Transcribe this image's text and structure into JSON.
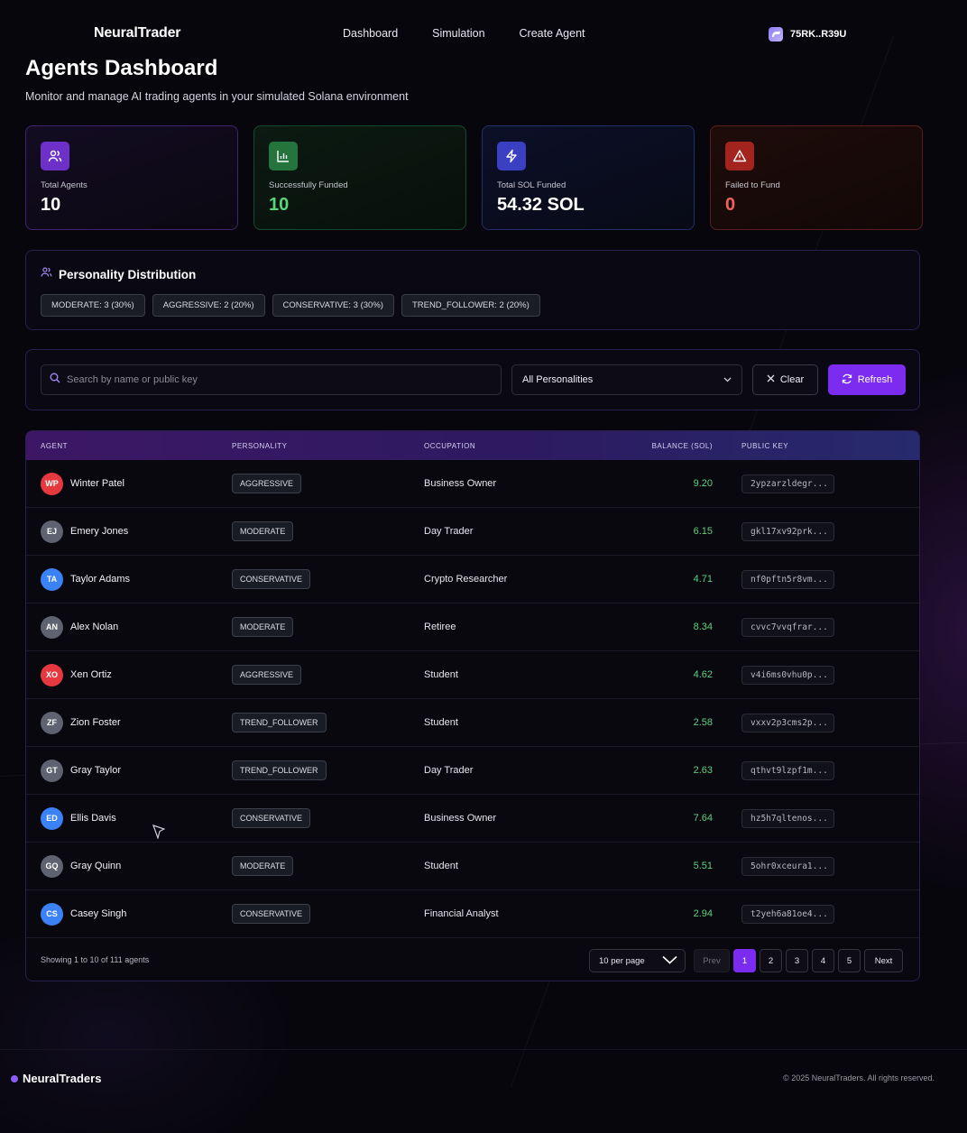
{
  "nav": {
    "brand": "NeuralTrader",
    "links": [
      "Dashboard",
      "Simulation",
      "Create Agent"
    ],
    "wallet": "75RK..R39U"
  },
  "header": {
    "title": "Agents Dashboard",
    "subtitle": "Monitor and manage AI trading agents in your simulated Solana environment"
  },
  "stats": [
    {
      "label": "Total Agents",
      "value": "10",
      "icon": "users-icon",
      "color": "#6d31c9"
    },
    {
      "label": "Successfully Funded",
      "value": "10",
      "icon": "bar-chart-icon",
      "color": "#25733d"
    },
    {
      "label": "Total SOL Funded",
      "value": "54.32 SOL",
      "icon": "lightning-icon",
      "color": "#3b3fc2"
    },
    {
      "label": "Failed to Fund",
      "value": "0",
      "icon": "warning-icon",
      "color": "#a3231e"
    }
  ],
  "distribution": {
    "title": "Personality Distribution",
    "tags": [
      "MODERATE: 3 (30%)",
      "AGGRESSIVE: 2 (20%)",
      "CONSERVATIVE: 3 (30%)",
      "TREND_FOLLOWER: 2 (20%)"
    ]
  },
  "filter": {
    "search_placeholder": "Search by name or public key",
    "personality_selected": "All Personalities",
    "clear_label": "Clear",
    "refresh_label": "Refresh"
  },
  "table": {
    "columns": [
      "AGENT",
      "PERSONALITY",
      "OCCUPATION",
      "BALANCE (SOL)",
      "PUBLIC KEY"
    ],
    "rows": [
      {
        "initials": "WP",
        "avatar_color": "#e5393f",
        "name": "Winter Patel",
        "personality": "AGGRESSIVE",
        "occupation": "Business Owner",
        "balance": "9.20",
        "key": "2ypzarzldegr..."
      },
      {
        "initials": "EJ",
        "avatar_color": "#5f6371",
        "name": "Emery Jones",
        "personality": "MODERATE",
        "occupation": "Day Trader",
        "balance": "6.15",
        "key": "gkl17xv92prk..."
      },
      {
        "initials": "TA",
        "avatar_color": "#3b82f6",
        "name": "Taylor Adams",
        "personality": "CONSERVATIVE",
        "occupation": "Crypto Researcher",
        "balance": "4.71",
        "key": "nf0pftn5r8vm..."
      },
      {
        "initials": "AN",
        "avatar_color": "#5f6371",
        "name": "Alex Nolan",
        "personality": "MODERATE",
        "occupation": "Retiree",
        "balance": "8.34",
        "key": "cvvc7vvqfrar..."
      },
      {
        "initials": "XO",
        "avatar_color": "#e5393f",
        "name": "Xen Ortiz",
        "personality": "AGGRESSIVE",
        "occupation": "Student",
        "balance": "4.62",
        "key": "v4i6ms0vhu0p..."
      },
      {
        "initials": "ZF",
        "avatar_color": "#5f6371",
        "name": "Zion Foster",
        "personality": "TREND_FOLLOWER",
        "occupation": "Student",
        "balance": "2.58",
        "key": "vxxv2p3cms2p..."
      },
      {
        "initials": "GT",
        "avatar_color": "#5f6371",
        "name": "Gray Taylor",
        "personality": "TREND_FOLLOWER",
        "occupation": "Day Trader",
        "balance": "2.63",
        "key": "qthvt9lzpf1m..."
      },
      {
        "initials": "ED",
        "avatar_color": "#3b82f6",
        "name": "Ellis Davis",
        "personality": "CONSERVATIVE",
        "occupation": "Business Owner",
        "balance": "7.64",
        "key": "hz5h7qltenos..."
      },
      {
        "initials": "GQ",
        "avatar_color": "#5f6371",
        "name": "Gray Quinn",
        "personality": "MODERATE",
        "occupation": "Student",
        "balance": "5.51",
        "key": "5ohr0xceura1..."
      },
      {
        "initials": "CS",
        "avatar_color": "#3b82f6",
        "name": "Casey Singh",
        "personality": "CONSERVATIVE",
        "occupation": "Financial Analyst",
        "balance": "2.94",
        "key": "t2yeh6a81oe4..."
      }
    ]
  },
  "pagination": {
    "showing": "Showing 1 to 10 of 111 agents",
    "per_page": "10 per page",
    "prev": "Prev",
    "pages": [
      "1",
      "2",
      "3",
      "4",
      "5"
    ],
    "current": "1",
    "next": "Next"
  },
  "footer": {
    "brand": "NeuralTraders",
    "copyright": "© 2025 NeuralTraders. All rights reserved."
  },
  "colors": {
    "accent": "#7c2cf0",
    "positive": "#5ed17f",
    "negative": "#f2605a"
  }
}
